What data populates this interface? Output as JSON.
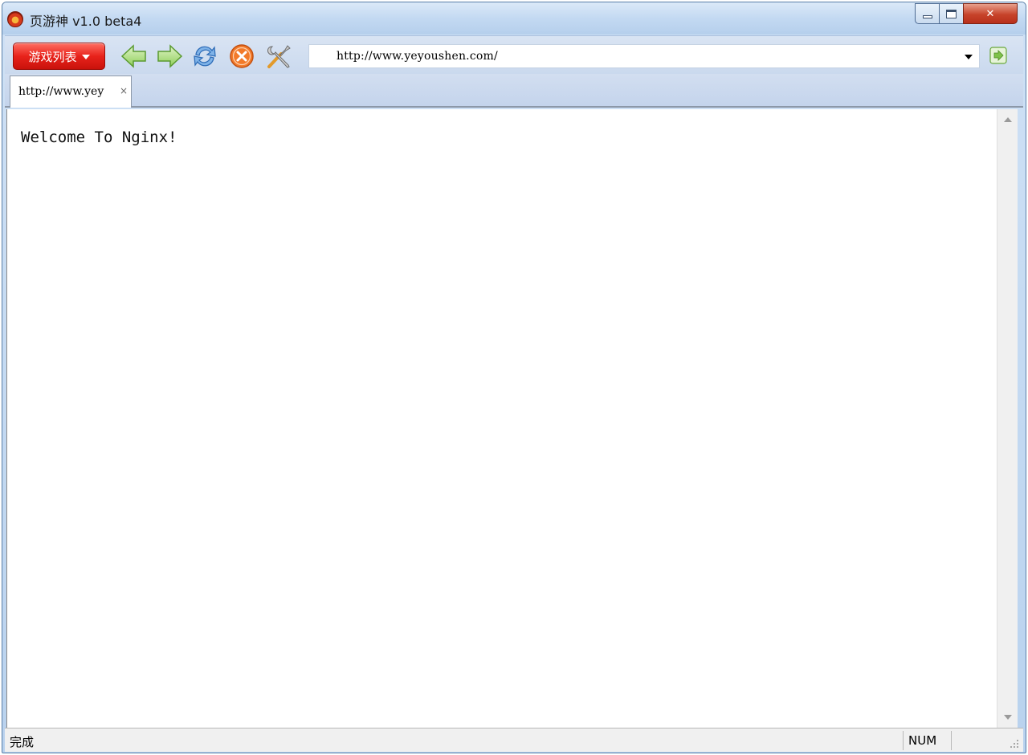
{
  "window": {
    "title": "页游神 v1.0 beta4",
    "controls": {
      "close_label": "✕"
    }
  },
  "toolbar": {
    "games_button_label": "游戏列表",
    "icons": [
      "back-arrow-icon",
      "forward-arrow-icon",
      "refresh-icon",
      "stop-icon",
      "tools-icon"
    ],
    "address_value": "http://www.yeyoushen.com/"
  },
  "tabs": [
    {
      "label": "http://www.yey",
      "close": "×"
    }
  ],
  "page": {
    "body_text": "Welcome To Nginx!"
  },
  "statusbar": {
    "status_text": "完成",
    "num_indicator": "NUM"
  },
  "colors": {
    "games_button": "#e8231b",
    "toolbar_bg": "#d9e4f3",
    "title_bg": "#c3d9f2",
    "arrow_green": "#7ec24a",
    "stop_orange": "#f27a2a"
  }
}
